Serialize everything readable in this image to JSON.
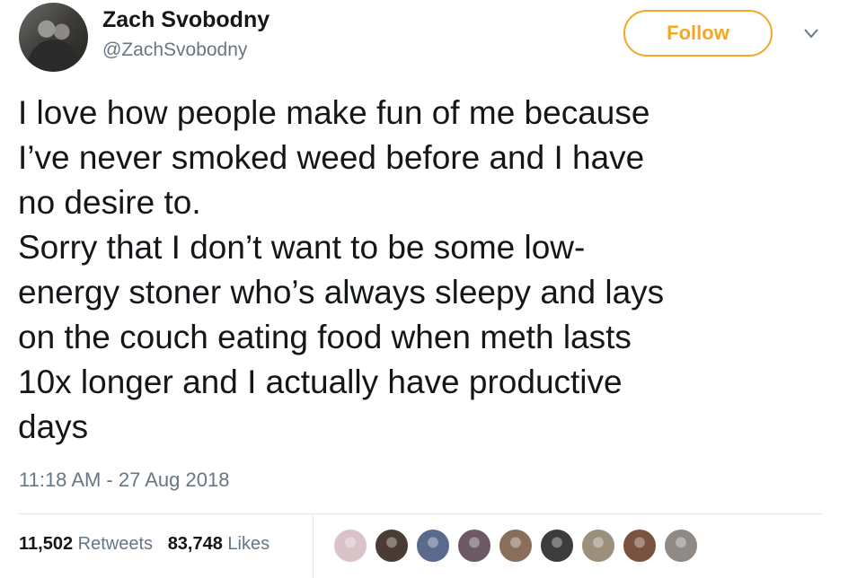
{
  "user": {
    "name": "Zach Svobodny",
    "handle": "@ZachSvobodny"
  },
  "follow_button": {
    "label": "Follow",
    "color": "#f5a623"
  },
  "more_menu_icon": "chevron-down-icon",
  "tweet": {
    "text": "I love how people make fun of me because\nI’ve never smoked weed before and I have\nno desire to.\nSorry that I don’t want to be some low-\nenergy stoner who’s always sleepy and lays\non the couch eating food when meth lasts\n10x longer and I actually have productive\ndays",
    "timestamp": "11:18 AM - 27 Aug 2018"
  },
  "stats": {
    "retweets_count": "11,502",
    "retweets_label": "Retweets",
    "likes_count": "83,748",
    "likes_label": "Likes"
  },
  "liker_avatars": [
    {
      "color": "#d9c2c8"
    },
    {
      "color": "#4a3b34"
    },
    {
      "color": "#5a6a8c"
    },
    {
      "color": "#6e5a66"
    },
    {
      "color": "#8a6e5c"
    },
    {
      "color": "#3c3c3c"
    },
    {
      "color": "#9c8f7c"
    },
    {
      "color": "#7a5240"
    },
    {
      "color": "#8f8a86"
    }
  ]
}
